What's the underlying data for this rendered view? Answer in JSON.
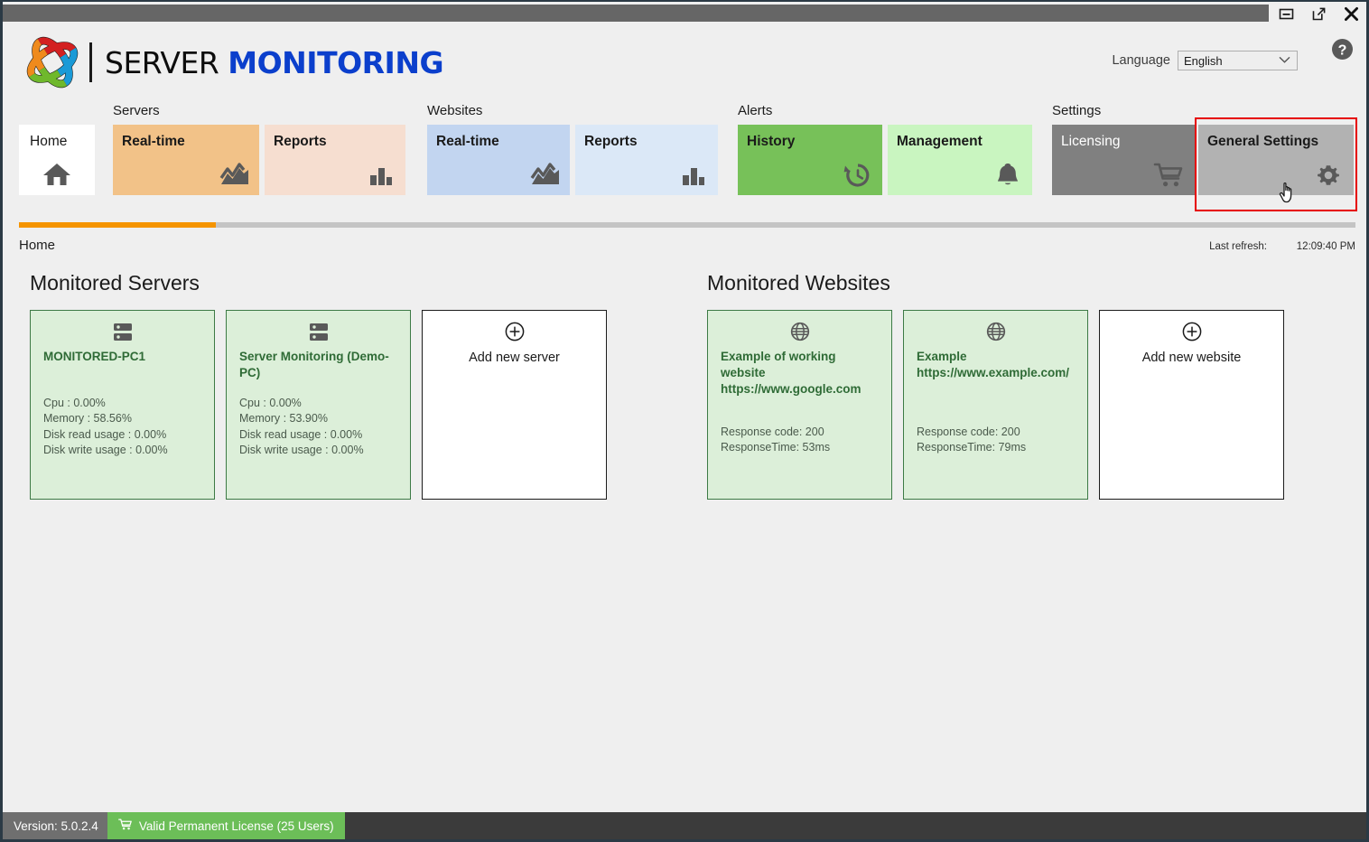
{
  "window": {
    "title": "",
    "buttons": [
      {
        "name": "minimize",
        "glyph": "minimize-icon"
      },
      {
        "name": "restore",
        "glyph": "external-window-icon"
      },
      {
        "name": "close",
        "glyph": "close-icon"
      }
    ]
  },
  "header": {
    "brand_part1": "SERVER ",
    "brand_part2": "MONITORING",
    "language_label": "Language",
    "language_value": "English",
    "language_options": [
      "English"
    ],
    "help_icon": "help-circle-icon"
  },
  "ribbon": {
    "home": {
      "label": "Home",
      "icon": "home-icon"
    },
    "groups": [
      {
        "label": "Servers",
        "tiles": [
          {
            "label": "Real-time",
            "icon": "area-chart-icon",
            "bg": "#f2c288",
            "selected": false
          },
          {
            "label": "Reports",
            "icon": "bar-chart-icon",
            "bg": "#f6ded0",
            "selected": false
          }
        ]
      },
      {
        "label": "Websites",
        "tiles": [
          {
            "label": "Real-time",
            "icon": "area-chart-icon",
            "bg": "#c2d5f0",
            "selected": false
          },
          {
            "label": "Reports",
            "icon": "bar-chart-icon",
            "bg": "#dbe8f7",
            "selected": false
          }
        ]
      },
      {
        "label": "Alerts",
        "tiles": [
          {
            "label": "History",
            "icon": "history-clock-icon",
            "bg": "#77c159",
            "selected": false
          },
          {
            "label": "Management",
            "icon": "bell-icon",
            "bg": "#c9f5c0",
            "selected": false
          }
        ]
      },
      {
        "label": "Settings",
        "tiles": [
          {
            "label": "Licensing",
            "icon": "cart-icon",
            "bg": "#808080",
            "selected": false
          },
          {
            "label": "General Settings",
            "icon": "gear-icon",
            "bg": "#b2b2b2",
            "selected": true
          }
        ]
      }
    ],
    "selection_color": "#e60000"
  },
  "progress": {
    "percent": 14.7,
    "fill_color": "#f59400",
    "track_color": "#c4c4c4"
  },
  "breadcrumb": {
    "text": "Home",
    "refresh_label": "Last refresh:",
    "refresh_time": "12:09:40 PM"
  },
  "servers_panel": {
    "title": "Monitored Servers",
    "cards": [
      {
        "type": "server",
        "icon": "server-rack-icon",
        "name": "MONITORED-PC1",
        "stats": "Cpu : 0.00%\nMemory : 58.56%\nDisk read usage : 0.00%\nDisk write usage : 0.00%"
      },
      {
        "type": "server",
        "icon": "server-rack-icon",
        "name": "Server Monitoring (Demo-PC)",
        "stats": "Cpu : 0.00%\nMemory : 53.90%\nDisk read usage : 0.00%\nDisk write usage : 0.00%"
      }
    ],
    "add_card": {
      "icon": "plus-circle-icon",
      "label": "Add new server"
    }
  },
  "websites_panel": {
    "title": "Monitored Websites",
    "cards": [
      {
        "type": "website",
        "icon": "globe-icon",
        "name": "Example of working website https://www.google.com",
        "stats": "Response code: 200\nResponseTime: 53ms"
      },
      {
        "type": "website",
        "icon": "globe-icon",
        "name": "Example https://www.example.com/",
        "stats": "Response code: 200\nResponseTime: 79ms"
      }
    ],
    "add_card": {
      "icon": "plus-circle-icon",
      "label": "Add new website"
    }
  },
  "statusbar": {
    "version": "Version: 5.0.2.4",
    "license_icon": "cart-icon",
    "license": "Valid Permanent License (25 Users)",
    "license_color": "#6cbe58"
  }
}
